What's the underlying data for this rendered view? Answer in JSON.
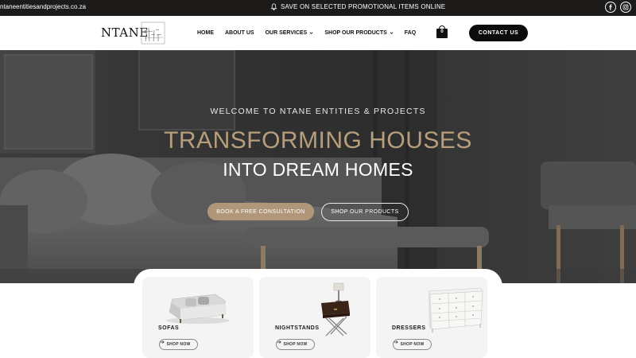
{
  "topbar": {
    "email": "ntaneentitiesandprojects.co.za",
    "promo": "SAVE ON SELECTED PROMOTIONAL ITEMS ONLINE"
  },
  "header": {
    "logo": "NTANE",
    "nav": [
      {
        "label": "HOME"
      },
      {
        "label": "ABOUT US"
      },
      {
        "label": "OUR SERVICES",
        "dropdown": true
      },
      {
        "label": "SHOP OUR PRODUCTS",
        "dropdown": true
      },
      {
        "label": "FAQ"
      }
    ],
    "cart_count": "0",
    "contact_label": "CONTACT US"
  },
  "hero": {
    "welcome": "WELCOME TO NTANE ENTITIES & PROJECTS",
    "headline": "TRANSFORMING HOUSES",
    "subheadline": "INTO DREAM HOMES",
    "consult_button": "BOOK A FREE CONSULTATION",
    "shop_button": "SHOP OUR PRODUCTS"
  },
  "products": [
    {
      "label": "SOFAS",
      "button": "SHOP NOW"
    },
    {
      "label": "NIGHTSTANDS",
      "button": "SHOP NOW"
    },
    {
      "label": "DRESSERS",
      "button": "SHOP NOW"
    }
  ],
  "colors": {
    "topbar_bg": "#1d1b1a",
    "accent_gold": "#b79f7c",
    "button_gold": "#b0977a",
    "dark_button": "#0b0b0b"
  },
  "icons": [
    "bell-icon",
    "facebook-icon",
    "instagram-icon",
    "chevron-down-icon",
    "shopping-bag-icon",
    "arrow-right-icon"
  ]
}
